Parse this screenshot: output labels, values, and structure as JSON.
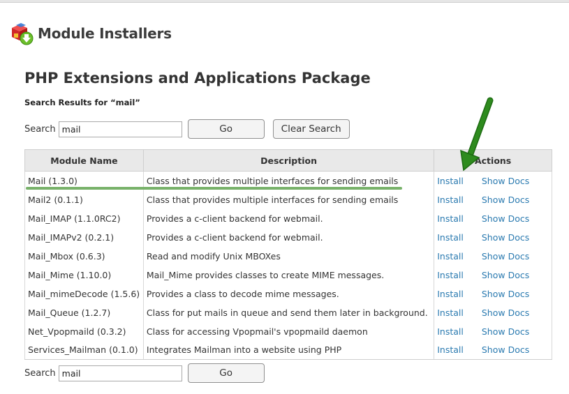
{
  "header": {
    "title": "Module Installers",
    "icon": "module-installer-icon"
  },
  "page": {
    "subtitle": "PHP Extensions and Applications Package",
    "results_text": "Search Results for “mail”"
  },
  "search_top": {
    "label": "Search",
    "value": "mail",
    "go_label": "Go",
    "clear_label": "Clear Search"
  },
  "search_bottom": {
    "label": "Search",
    "value": "mail",
    "go_label": "Go"
  },
  "table": {
    "headers": [
      "Module Name",
      "Description",
      "Actions"
    ],
    "rows": [
      {
        "name": "Mail (1.3.0)",
        "description": "Class that provides multiple interfaces for sending emails",
        "install": "Install",
        "docs": "Show Docs"
      },
      {
        "name": "Mail2 (0.1.1)",
        "description": "Class that provides multiple interfaces for sending emails",
        "install": "Install",
        "docs": "Show Docs"
      },
      {
        "name": "Mail_IMAP (1.1.0RC2)",
        "description": "Provides a c-client backend for webmail.",
        "install": "Install",
        "docs": "Show Docs"
      },
      {
        "name": "Mail_IMAPv2 (0.2.1)",
        "description": "Provides a c-client backend for webmail.",
        "install": "Install",
        "docs": "Show Docs"
      },
      {
        "name": "Mail_Mbox (0.6.3)",
        "description": "Read and modify Unix MBOXes",
        "install": "Install",
        "docs": "Show Docs"
      },
      {
        "name": "Mail_Mime (1.10.0)",
        "description": "Mail_Mime provides classes to create MIME messages.",
        "install": "Install",
        "docs": "Show Docs"
      },
      {
        "name": "Mail_mimeDecode (1.5.6)",
        "description": "Provides a class to decode mime messages.",
        "install": "Install",
        "docs": "Show Docs"
      },
      {
        "name": "Mail_Queue (1.2.7)",
        "description": "Class for put mails in queue and send them later in background.",
        "install": "Install",
        "docs": "Show Docs"
      },
      {
        "name": "Net_Vpopmaild (0.3.2)",
        "description": "Class for accessing Vpopmail's vpopmaild daemon",
        "install": "Install",
        "docs": "Show Docs"
      },
      {
        "name": "Services_Mailman (0.1.0)",
        "description": "Integrates Mailman into a website using PHP",
        "install": "Install",
        "docs": "Show Docs"
      }
    ]
  },
  "colors": {
    "link": "#2a7ab0",
    "highlight_underline": "#78b26a",
    "arrow": "#2e8b1e",
    "header_bg": "#e9e9e9"
  }
}
